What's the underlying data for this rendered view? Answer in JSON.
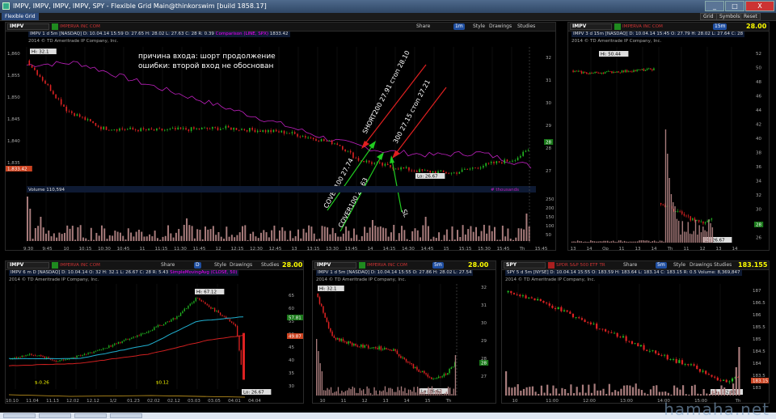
{
  "window": {
    "title": "IMPV, IMPV, IMPV, IMPV, SPY - Flexible Grid Main@thinkorswim [build 1858.17]",
    "menu_tab": "Flexible Grid",
    "right_buttons": [
      "Grid",
      "Symbols",
      "Reset"
    ],
    "controls": [
      "_",
      "□",
      "X"
    ]
  },
  "toolbar": {
    "share": "Share",
    "style": "Style",
    "drawings": "Drawings",
    "studies": "Studies"
  },
  "watermark": "hamaha.net",
  "colors": {
    "up": "#22aa22",
    "down": "#dd2222",
    "comparison": "#cc22cc",
    "price": "#ffff00",
    "accent": "#1f4ea0"
  },
  "main": {
    "symbol": "IMPV",
    "company": "IMPERVA INC COM",
    "aggregation": "1m",
    "price": "28.00",
    "info": "IMPV 1 d 5m [NASDAQ]  D: 10.04.14 15:59  O: 27.65  H: 28.02  L: 27.63  C: 28  R: 0.39",
    "comparison": "Comparison (LINE, SPX)",
    "comparison_value": "1833.42",
    "copyright": "2014 © TD Ameritrade IP Company, Inc.",
    "note_line1": "причина входа: шорт продолжение",
    "note_line2": "ошибки: второй вход не обоснован",
    "annotations": [
      "SHORT200 27.91 стоп 28.10",
      "300 27.15 стоп 27.21",
      "COVER100 27.74",
      "COVER100 27.63",
      "SL"
    ],
    "high_label": "Hi: 32.1",
    "low_label": "Lo: 26.67",
    "left_scale": [
      "1,860",
      "1,855",
      "1,850",
      "1,845",
      "1,840",
      "1,835"
    ],
    "left_marker": "1,833.42",
    "right_scale": [
      "32",
      "31",
      "30",
      "29",
      "28",
      "27"
    ],
    "volume_label": "Volume",
    "volume_value": "110,594",
    "volume_units": "# thousands",
    "volume_scale": [
      "250",
      "200",
      "150",
      "100",
      "50"
    ],
    "x_labels": [
      "9:30",
      "9:45",
      "10",
      "10:15",
      "10:30",
      "10:45",
      "11",
      "11:15",
      "11:30",
      "11:45",
      "12",
      "12:15",
      "12:30",
      "12:45",
      "13",
      "13:15",
      "13:30",
      "13:45",
      "14",
      "14:15",
      "14:30",
      "14:45",
      "15",
      "15:15",
      "15:30",
      "15:45",
      "Th",
      "15:45"
    ],
    "price_marker": "28"
  },
  "tr": {
    "symbol": "IMPV",
    "company": "IMPERVA INC COM",
    "aggregation": "15m",
    "price": "28.00",
    "info": "IMPV 3 d 15m [NASDAQ]  D: 10.04.14 15:45  O: 27.79  H: 28.02  L: 27.64  C: 28",
    "copyright": "2014 © TD Ameritrade IP Company, Inc.",
    "high_label": "Hi: 50.44",
    "low_label": "Lo: 26.67",
    "right_scale": [
      "52",
      "50",
      "48",
      "46",
      "44",
      "42",
      "40",
      "38",
      "36",
      "34",
      "32",
      "30",
      "28",
      "26"
    ],
    "x_labels": [
      "13",
      "14",
      "Op",
      "11",
      "13",
      "14",
      "Th",
      "11",
      "12",
      "13",
      "14"
    ],
    "price_marker": "28"
  },
  "bl": {
    "symbol": "IMPV",
    "company": "IMPERVA INC COM",
    "aggregation": "D",
    "price": "28.00",
    "info": "IMPV 6 m D [NASDAQ]  D: 10.04.14  O: 32  H: 32.1  L: 26.67  C: 28  R: 5.43",
    "info2": "SimpleMovingAvg (CLOSE, 50)",
    "copyright": "2014 © TD Ameritrade IP Company, Inc.",
    "high_label": "Hi: 67.12",
    "low_label": "Lo: 26.67",
    "earn1": "$-0.26",
    "earn2": "$0.12",
    "right_scale": [
      "65",
      "60",
      "55",
      "50",
      "45",
      "40",
      "35",
      "30"
    ],
    "sma_marker": "57.81",
    "price_marker": "49.87",
    "x_labels": [
      "10.10",
      "11.04",
      "11.13",
      "12.02",
      "12.12",
      "1/2",
      "01.23",
      "02.02",
      "02.12",
      "03.03",
      "03.05",
      "04.01",
      "04.04"
    ]
  },
  "bm": {
    "symbol": "IMPV",
    "company": "IMPERVA INC COM",
    "aggregation": "5m",
    "price": "28.00",
    "info": "IMPV 1 d 5m [NASDAQ]  D: 10.04.14 15:55  O: 27.86  H: 28.02  L: 27.54",
    "copyright": "2014 © TD Ameritrade IP Company, Inc.",
    "high_label": "Hi: 32.1",
    "low_label": "Lo: 26.67",
    "right_scale": [
      "32",
      "31",
      "30",
      "29",
      "28",
      "27"
    ],
    "x_labels": [
      "10",
      "11",
      "12",
      "13",
      "14",
      "15",
      "Th"
    ],
    "price_marker": "28"
  },
  "br": {
    "symbol": "SPY",
    "company": "SPDR S&P 500 ETF TR",
    "aggregation": "5m",
    "price": "183.155",
    "info": "SPY 5 d 5m [NYSE]  D: 10.04.14 15:55  O: 183.59  H: 183.64  L: 183.14  C: 183.15  R: 0.5  Volume: 8,369,847",
    "copyright": "2014 © TD Ameritrade IP Company, Inc.",
    "low_label": "Lo: 182.93",
    "right_scale": [
      "187",
      "186.5",
      "186",
      "185.5",
      "185",
      "184.5",
      "184",
      "183.5",
      "183"
    ],
    "x_labels": [
      "10",
      "11:00",
      "12:00",
      "13:00",
      "14:00",
      "15:00",
      "Th"
    ],
    "price_marker": "183.15"
  }
}
